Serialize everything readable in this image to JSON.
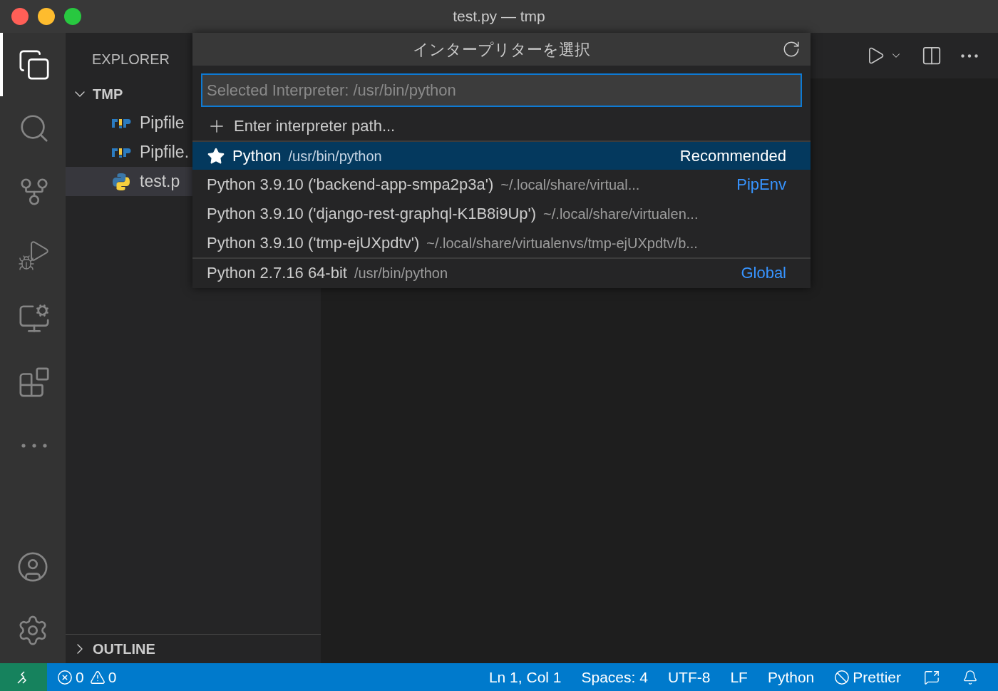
{
  "window": {
    "title": "test.py — tmp"
  },
  "activity_bar": [
    {
      "kind": "files",
      "selected": true
    },
    {
      "kind": "search",
      "selected": false
    },
    {
      "kind": "source-control",
      "selected": false
    },
    {
      "kind": "run-debug",
      "selected": false
    },
    {
      "kind": "remote",
      "selected": false
    },
    {
      "kind": "extensions",
      "selected": false
    },
    {
      "kind": "more",
      "selected": false
    }
  ],
  "activity_bar_bottom": [
    {
      "kind": "account"
    },
    {
      "kind": "settings"
    }
  ],
  "sidebar": {
    "title": "EXPLORER",
    "folder": {
      "label": "TMP",
      "expanded": true,
      "children": [
        {
          "label": "Pipfile",
          "kind": "pipenv",
          "selected": false
        },
        {
          "label": "Pipfile.",
          "kind": "pipenv",
          "selected": false
        },
        {
          "label": "test.p",
          "kind": "python",
          "selected": true
        }
      ]
    },
    "outline": {
      "label": "OUTLINE",
      "expanded": false
    }
  },
  "quick_pick": {
    "title": "インタープリターを選択",
    "input": {
      "placeholder": "Selected Interpreter: /usr/bin/python"
    },
    "items": [
      {
        "kind": "action",
        "label": "Enter interpreter path...",
        "selected": false,
        "separator_above": false
      },
      {
        "kind": "interpreter",
        "label": "Python",
        "description": "/usr/bin/python",
        "badge": "Recommended",
        "starred": true,
        "selected": true,
        "separator_above": true
      },
      {
        "kind": "interpreter",
        "label": "Python 3.9.10 ('backend-app-smpa2p3a')",
        "description": "~/.local/share/virtual...",
        "badge": "PipEnv",
        "starred": false,
        "selected": false,
        "separator_above": false
      },
      {
        "kind": "interpreter",
        "label": "Python 3.9.10 ('django-rest-graphql-K1B8i9Up')",
        "description": "~/.local/share/virtualen...",
        "starred": false,
        "selected": false,
        "separator_above": false
      },
      {
        "kind": "interpreter",
        "label": "Python 3.9.10 ('tmp-ejUXpdtv')",
        "description": "~/.local/share/virtualenvs/tmp-ejUXpdtv/b...",
        "starred": false,
        "selected": false,
        "separator_above": false
      },
      {
        "kind": "interpreter",
        "label": "Python 2.7.16 64-bit",
        "description": "/usr/bin/python",
        "badge": "Global",
        "starred": false,
        "selected": false,
        "separator_above": true
      }
    ]
  },
  "status_bar": [
    {
      "kind": "remote"
    },
    {
      "kind": "problems",
      "errors": "0",
      "warnings": "0"
    },
    {
      "kind": "text",
      "label": "Ln 1, Col 1"
    },
    {
      "kind": "text",
      "label": "Spaces: 4"
    },
    {
      "kind": "text",
      "label": "UTF-8"
    },
    {
      "kind": "text",
      "label": "LF"
    },
    {
      "kind": "text",
      "label": "Python"
    },
    {
      "kind": "prettier",
      "label": "Prettier"
    },
    {
      "kind": "feedback"
    },
    {
      "kind": "bell"
    }
  ]
}
